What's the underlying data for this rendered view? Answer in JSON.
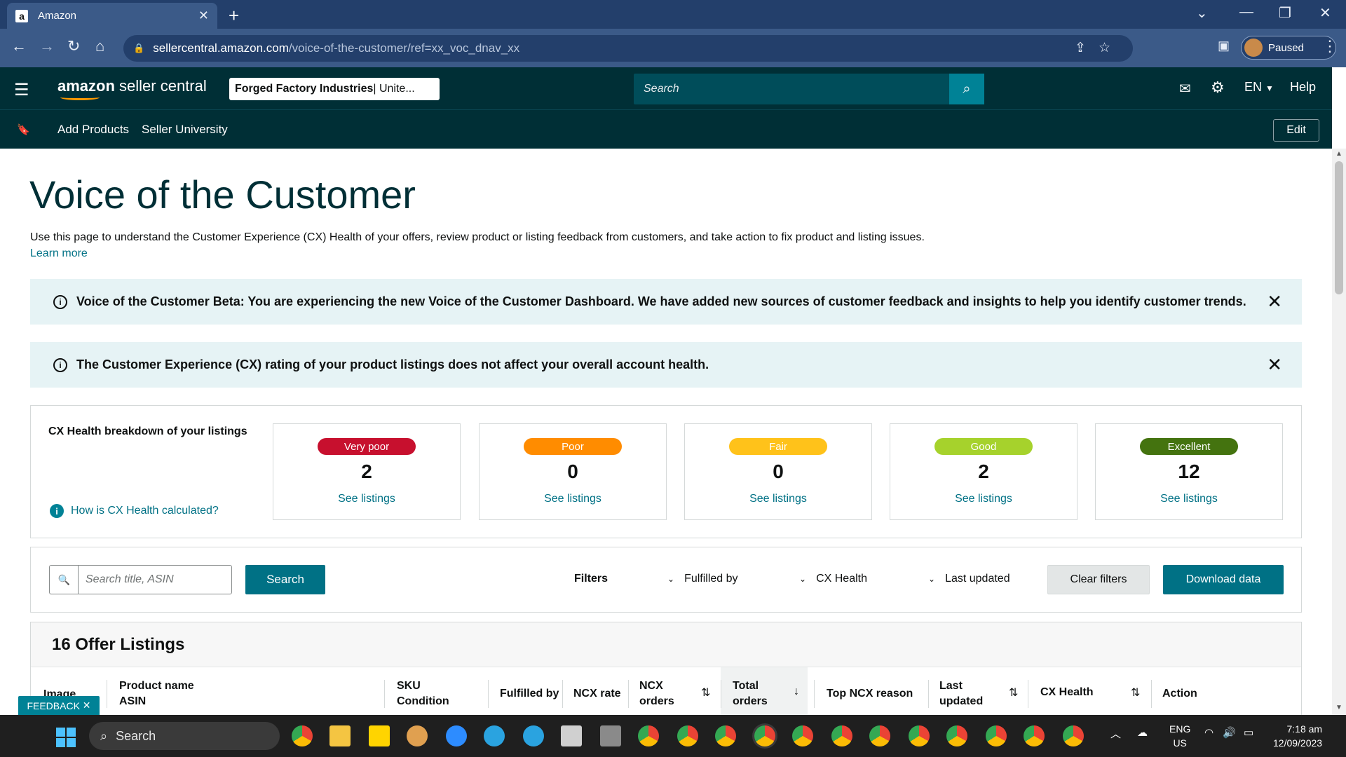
{
  "browser": {
    "tab_title": "Amazon",
    "favicon": "a",
    "url_host": "sellercentral.amazon.com",
    "url_path": "/voice-of-the-customer/ref=xx_voc_dnav_xx",
    "profile_label": "Paused"
  },
  "header": {
    "logo_main": "amazon",
    "logo_sub": " seller central",
    "store_name": "Forged Factory Industries",
    "store_region": " | Unite...",
    "search_placeholder": "Search",
    "lang": "EN",
    "help": "Help"
  },
  "subnav": {
    "links": [
      "Add Products",
      "Seller University"
    ],
    "edit": "Edit"
  },
  "page": {
    "title": "Voice of the Customer",
    "description": "Use this page to understand the Customer Experience (CX) Health of your offers, review product or listing feedback from customers, and take action to fix product and listing issues.",
    "learn_more": "Learn more"
  },
  "alerts": [
    {
      "text": "Voice of the Customer Beta: You are experiencing the new Voice of the Customer Dashboard. We have added new sources of customer feedback and insights to help you identify customer trends."
    },
    {
      "text": "The Customer Experience (CX) rating of your product listings does not affect your overall account health."
    }
  ],
  "cx_health": {
    "heading": "CX Health breakdown of your listings",
    "help_link": "How is CX Health calculated?",
    "cards": [
      {
        "label": "Very poor",
        "count": "2",
        "link": "See listings",
        "color": "#c7102e"
      },
      {
        "label": "Poor",
        "count": "0",
        "link": "See listings",
        "color": "#ff8c00"
      },
      {
        "label": "Fair",
        "count": "0",
        "link": "See listings",
        "color": "#ffc21a"
      },
      {
        "label": "Good",
        "count": "2",
        "link": "See listings",
        "color": "#a6d22c"
      },
      {
        "label": "Excellent",
        "count": "12",
        "link": "See listings",
        "color": "#44730f"
      }
    ]
  },
  "filters": {
    "search_placeholder": "Search title, ASIN",
    "search_button": "Search",
    "label": "Filters",
    "dropdowns": [
      "Fulfilled by",
      "CX Health",
      "Last updated"
    ],
    "clear": "Clear filters",
    "download": "Download data"
  },
  "table": {
    "heading": "16 Offer Listings",
    "columns": {
      "image": "Image",
      "product_name": "Product name",
      "asin": "ASIN",
      "sku": "SKU",
      "condition": "Condition",
      "fulfilled_by": "Fulfilled by",
      "ncx_rate": "NCX rate",
      "ncx_orders_1": "NCX",
      "ncx_orders_2": "orders",
      "total_orders_1": "Total",
      "total_orders_2": "orders",
      "top_ncx_reason": "Top NCX reason",
      "last_updated_1": "Last",
      "last_updated_2": "updated",
      "cx_health": "CX Health",
      "action": "Action"
    }
  },
  "feedback": "FEEDBACK",
  "taskbar": {
    "search": "Search",
    "lang_1": "ENG",
    "lang_2": "US",
    "time": "7:18 am",
    "date": "12/09/2023"
  }
}
